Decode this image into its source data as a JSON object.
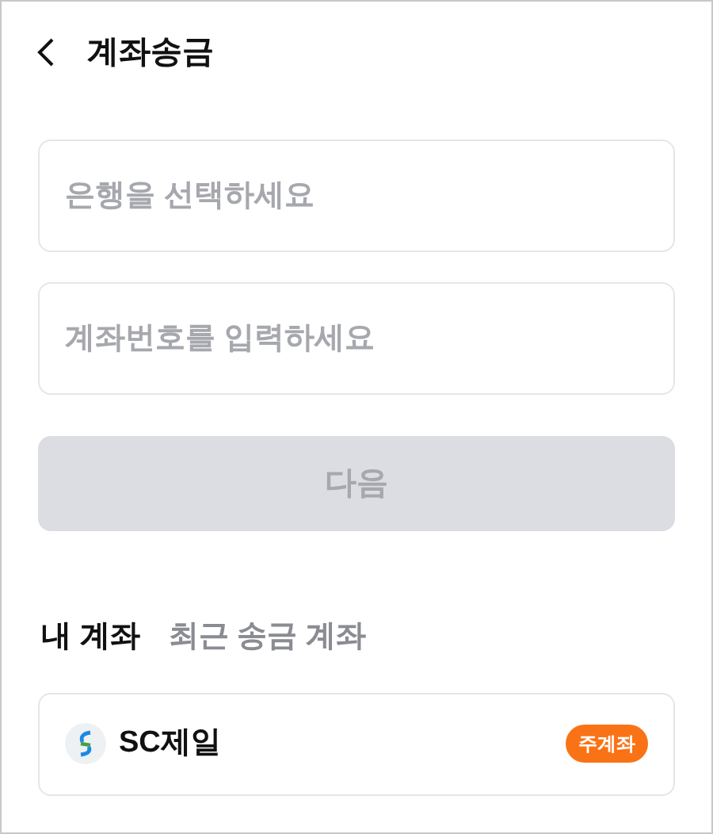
{
  "header": {
    "title": "계좌송금"
  },
  "fields": [
    {
      "placeholder": "은행을 선택하세요"
    },
    {
      "placeholder": "계좌번호를 입력하세요"
    }
  ],
  "next_button": {
    "label": "다음",
    "disabled": true
  },
  "tabs": [
    {
      "label": "내 계좌",
      "selected": true
    },
    {
      "label": "최근 송금 계좌",
      "selected": false
    }
  ],
  "accounts": [
    {
      "bank": "SC제일",
      "badge": "주계좌"
    }
  ]
}
